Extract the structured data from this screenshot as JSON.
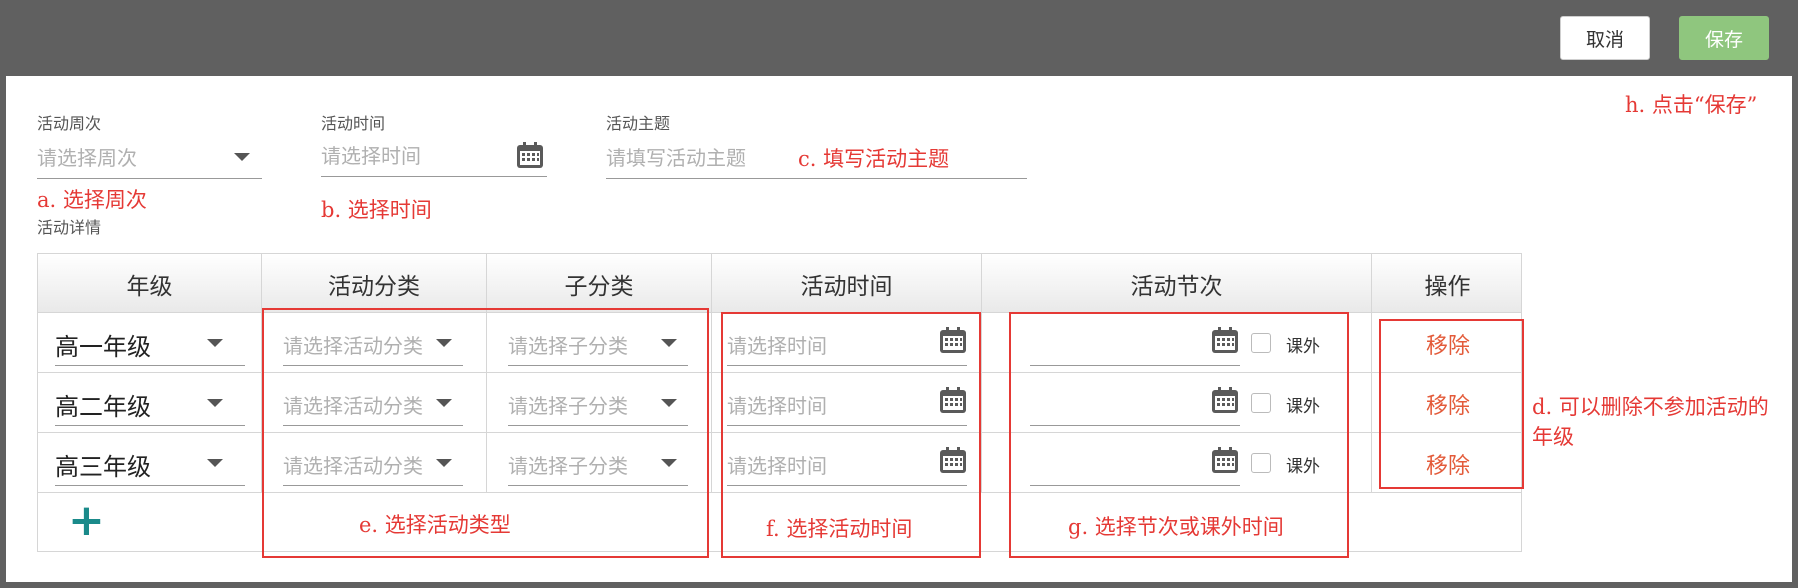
{
  "toolbar": {
    "cancel_label": "取消",
    "save_label": "保存"
  },
  "form": {
    "week": {
      "label": "活动周次",
      "placeholder": "请选择周次"
    },
    "time": {
      "label": "活动时间",
      "placeholder": "请选择时间"
    },
    "theme": {
      "label": "活动主题",
      "placeholder": "请填写活动主题"
    },
    "details_label": "活动详情"
  },
  "table": {
    "headers": [
      "年级",
      "活动分类",
      "子分类",
      "活动时间",
      "活动节次",
      "操作"
    ],
    "rows": [
      {
        "grade": "高一年级",
        "category_placeholder": "请选择活动分类",
        "subcategory_placeholder": "请选择子分类",
        "time_placeholder": "请选择时间",
        "extracurricular_label": "课外",
        "remove_label": "移除"
      },
      {
        "grade": "高二年级",
        "category_placeholder": "请选择活动分类",
        "subcategory_placeholder": "请选择子分类",
        "time_placeholder": "请选择时间",
        "extracurricular_label": "课外",
        "remove_label": "移除"
      },
      {
        "grade": "高三年级",
        "category_placeholder": "请选择活动分类",
        "subcategory_placeholder": "请选择子分类",
        "time_placeholder": "请选择时间",
        "extracurricular_label": "课外",
        "remove_label": "移除"
      }
    ],
    "add_icon": "plus-icon"
  },
  "annotations": {
    "a": "a. 选择周次",
    "b": "b. 选择时间",
    "c": "c. 填写活动主题",
    "d_line1": "d. 可以删除不参加活动的",
    "d_line2": "年级",
    "e": "e. 选择活动类型",
    "f": "f. 选择活动时间",
    "g": "g. 选择节次或课外时间",
    "h": "h. 点击“保存”"
  },
  "colors": {
    "topbar": "#606060",
    "save": "#8fc67e",
    "annotation": "#e53935",
    "remove": "#e35b3a",
    "add": "#1a8a8a"
  },
  "icons": [
    "calendar-icon",
    "chevron-down-icon",
    "plus-icon",
    "checkbox-icon"
  ]
}
